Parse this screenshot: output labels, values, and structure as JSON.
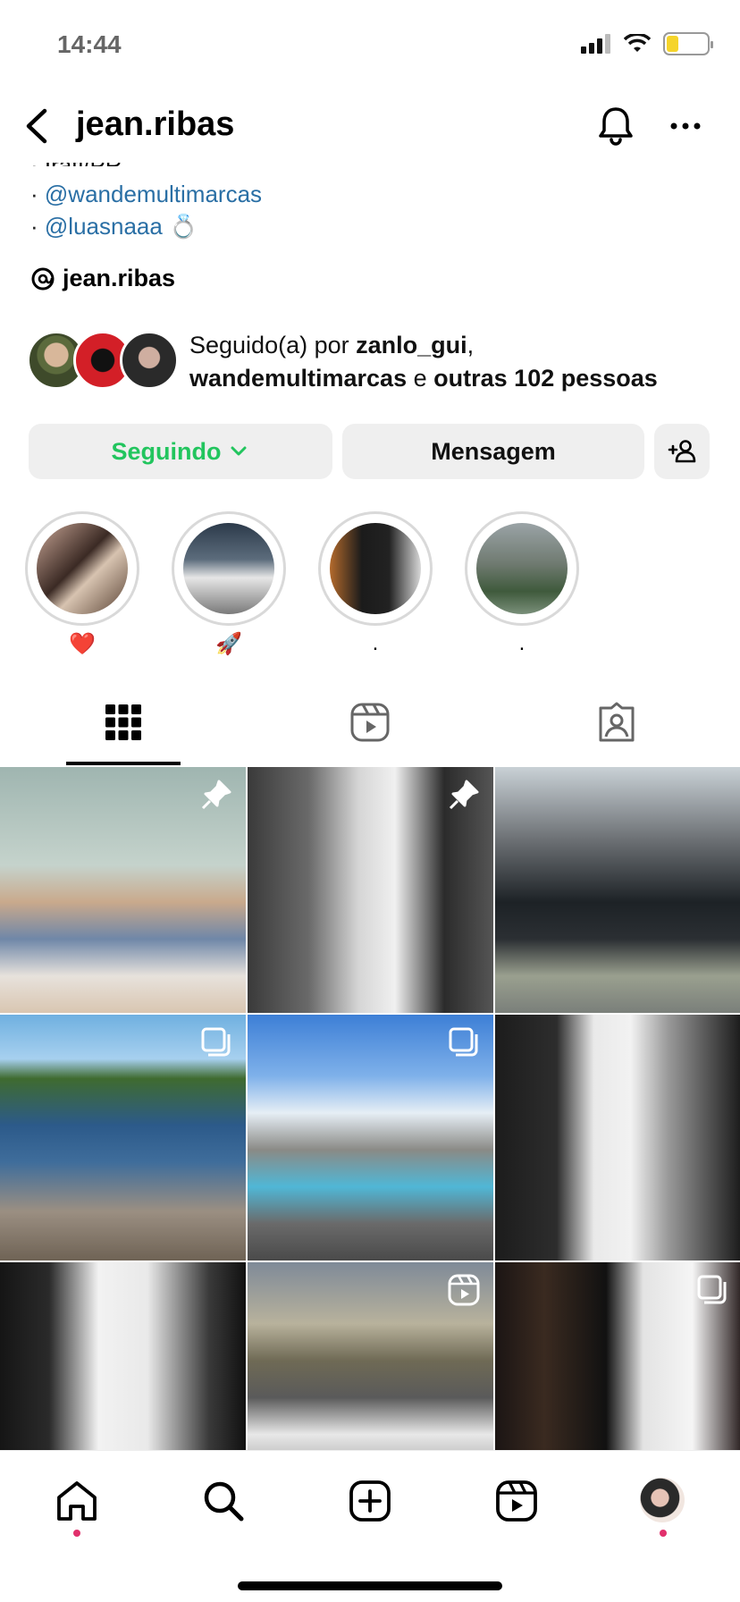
{
  "status": {
    "time": "14:44"
  },
  "header": {
    "username": "jean.ribas"
  },
  "bio": {
    "cut_line": "· Irati/PR",
    "lines": [
      {
        "bullet": "·",
        "mention": "@wandemultimarcas",
        "emoji": ""
      },
      {
        "bullet": "·",
        "mention": "@luasnaaa",
        "emoji": "💍"
      }
    ],
    "threads_handle": "jean.ribas"
  },
  "followed_by": {
    "prefix": "Seguido(a) por",
    "user1": "zanlo_gui",
    "user2": "wandemultimarcas",
    "connector": "e",
    "others": "outras 102 pessoas"
  },
  "buttons": {
    "following": "Seguindo",
    "message": "Mensagem"
  },
  "highlights": [
    {
      "label": "❤️"
    },
    {
      "label": "🚀"
    },
    {
      "label": "."
    },
    {
      "label": "."
    }
  ],
  "colors": {
    "mention": "#2a6fa5",
    "following": "#22c55e",
    "notification_dot": "#e1306c"
  },
  "icons": [
    "back-icon",
    "bell-icon",
    "more-icon",
    "threads-icon",
    "chevron-down-icon",
    "add-person-icon",
    "grid-icon",
    "reels-icon",
    "tagged-icon",
    "pin-icon",
    "carousel-icon",
    "home-icon",
    "search-icon",
    "create-icon"
  ]
}
